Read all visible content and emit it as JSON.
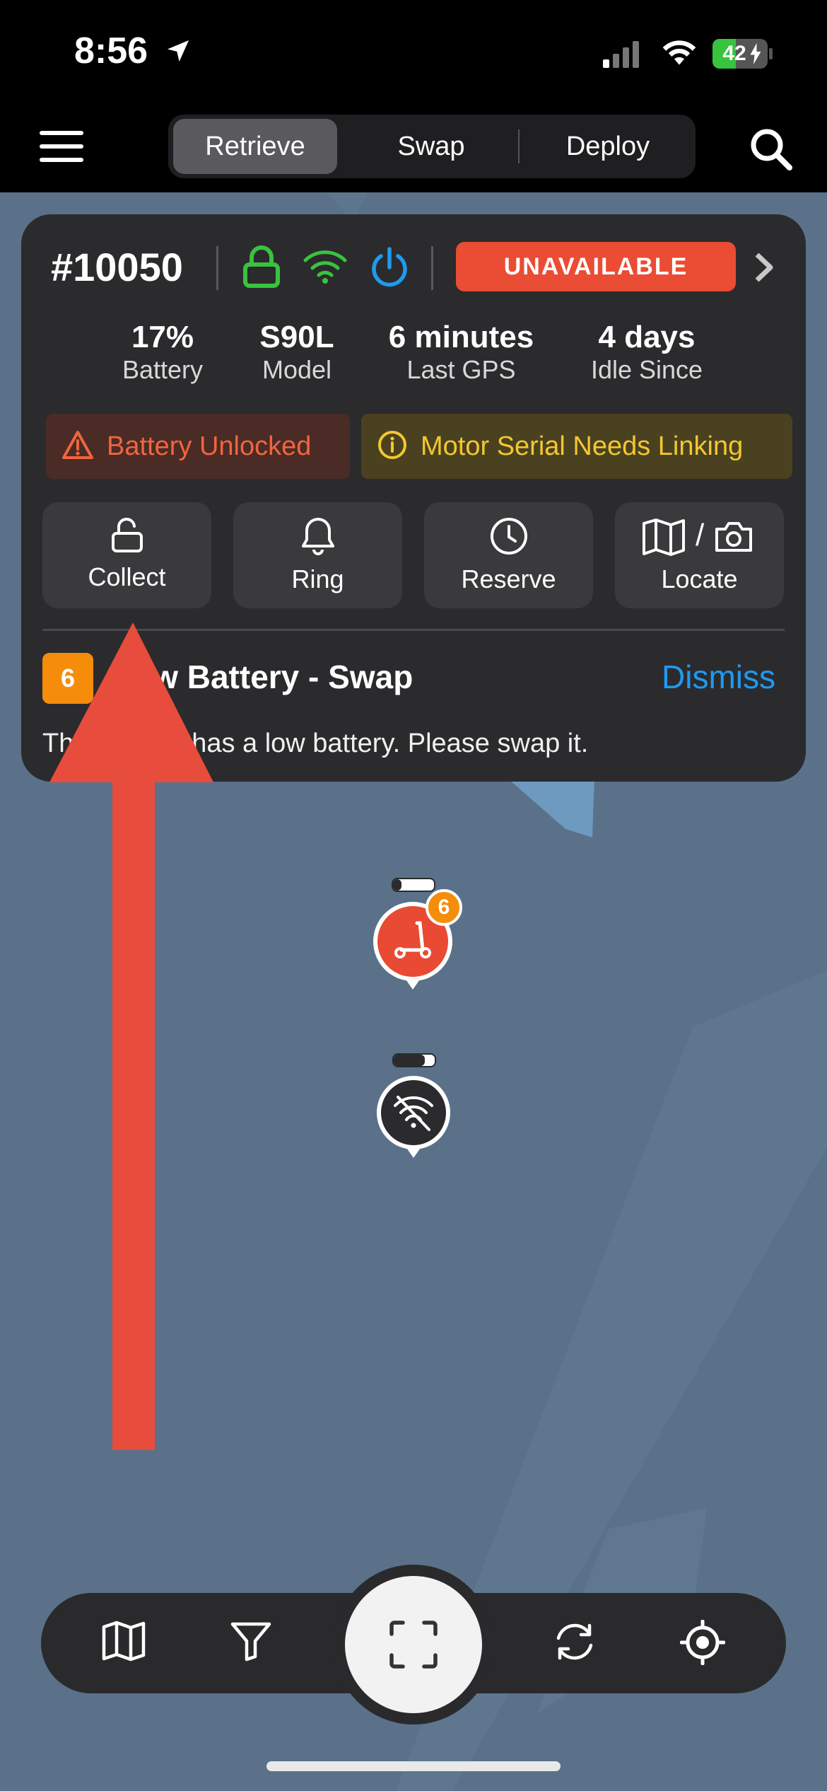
{
  "status_bar": {
    "time": "8:56",
    "battery_percent": "42",
    "battery_charging": true
  },
  "top_nav": {
    "tabs": [
      {
        "label": "Retrieve",
        "active": true
      },
      {
        "label": "Swap",
        "active": false
      },
      {
        "label": "Deploy",
        "active": false
      }
    ],
    "menu_icon": "hamburger-icon",
    "search_icon": "search-icon"
  },
  "vehicle_card": {
    "id": "#10050",
    "status_icons": [
      "lock-icon",
      "wifi-icon",
      "power-icon"
    ],
    "status_badge": "UNAVAILABLE",
    "stats": [
      {
        "value": "17%",
        "label": "Battery"
      },
      {
        "value": "S90L",
        "label": "Model"
      },
      {
        "value": "6 minutes",
        "label": "Last GPS"
      },
      {
        "value": "4 days",
        "label": "Idle Since"
      }
    ],
    "warnings": [
      {
        "text": "Battery Unlocked",
        "color": "#f0653f",
        "icon": "warning-triangle-icon"
      },
      {
        "text": "Motor Serial Needs Linking",
        "color": "#f3c72f",
        "icon": "info-circle-icon"
      }
    ],
    "actions": [
      {
        "label": "Collect",
        "icon": "unlock-icon"
      },
      {
        "label": "Ring",
        "icon": "bell-icon"
      },
      {
        "label": "Reserve",
        "icon": "clock-icon"
      },
      {
        "label": "Locate",
        "icon": "map-camera-icon",
        "separator": "/"
      }
    ],
    "alert": {
      "count": "6",
      "title": "Low Battery - Swap",
      "dismiss_label": "Dismiss",
      "body": "This vehicle has a low battery. Please swap it."
    }
  },
  "map": {
    "markers": [
      {
        "type": "scooter",
        "badge": "6",
        "color": "#e84a33"
      },
      {
        "type": "offline",
        "color": "#2b2b2d"
      }
    ]
  },
  "bottom_bar": {
    "icons": [
      "map-icon",
      "filter-icon",
      "scan-icon",
      "refresh-icon",
      "locate-crosshair-icon"
    ]
  },
  "colors": {
    "accent_red": "#ea4c34",
    "accent_blue": "#1e9bf0",
    "ok_green": "#39c33f",
    "warn_orange": "#f58d0b",
    "map_bg": "#5a7189"
  }
}
